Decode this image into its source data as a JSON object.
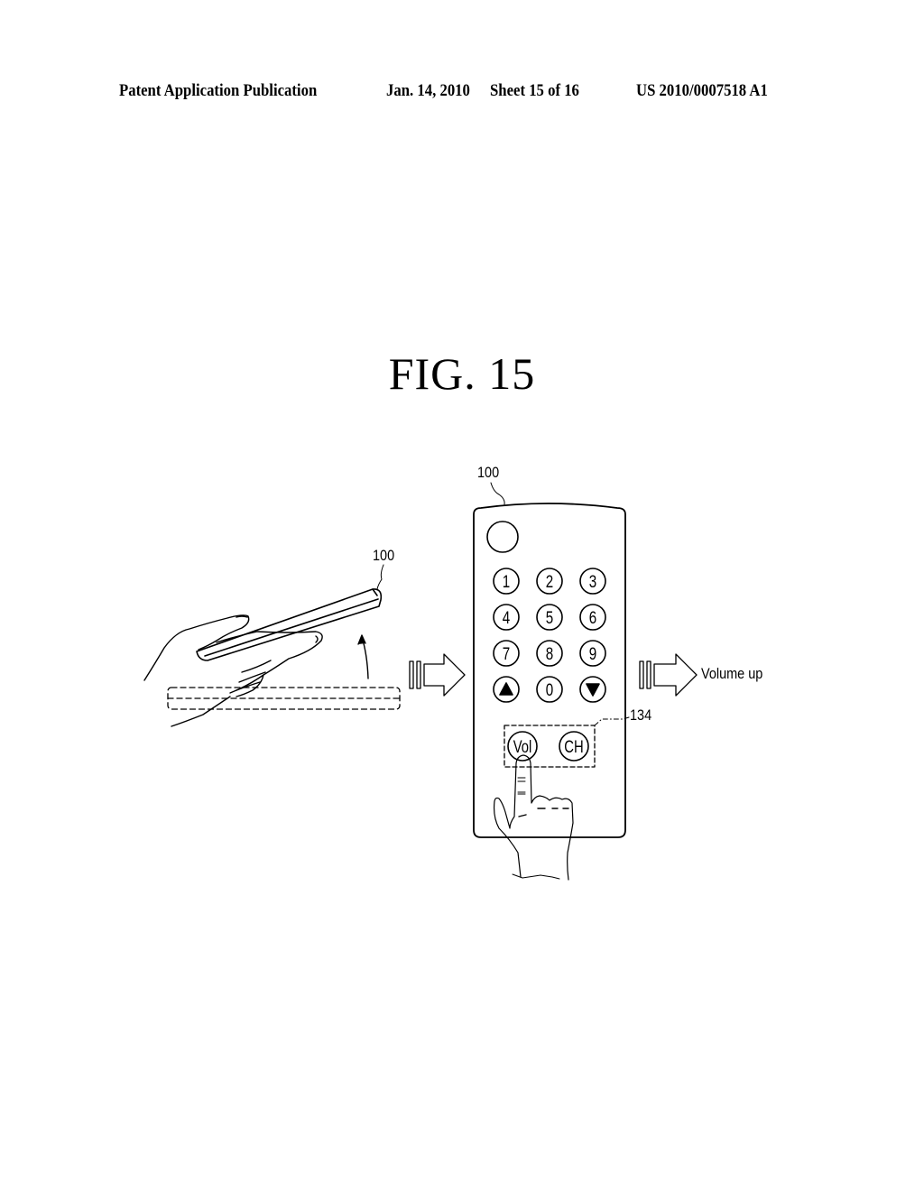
{
  "header": {
    "publication": "Patent Application Publication",
    "date": "Jan. 14, 2010",
    "sheet": "Sheet 15 of 16",
    "number": "US 2010/0007518 A1"
  },
  "figure": {
    "title": "FIG.  15",
    "labels": {
      "tilted_device_ref": "100",
      "remote_ref": "100",
      "touch_region_ref": "134",
      "result_text": "Volume up"
    },
    "remote": {
      "keypad": [
        [
          "1",
          "2",
          "3"
        ],
        [
          "4",
          "5",
          "6"
        ],
        [
          "7",
          "8",
          "9"
        ],
        [
          "▲",
          "0",
          "▼"
        ]
      ],
      "function_keys": [
        "Vol",
        "CH"
      ]
    }
  }
}
